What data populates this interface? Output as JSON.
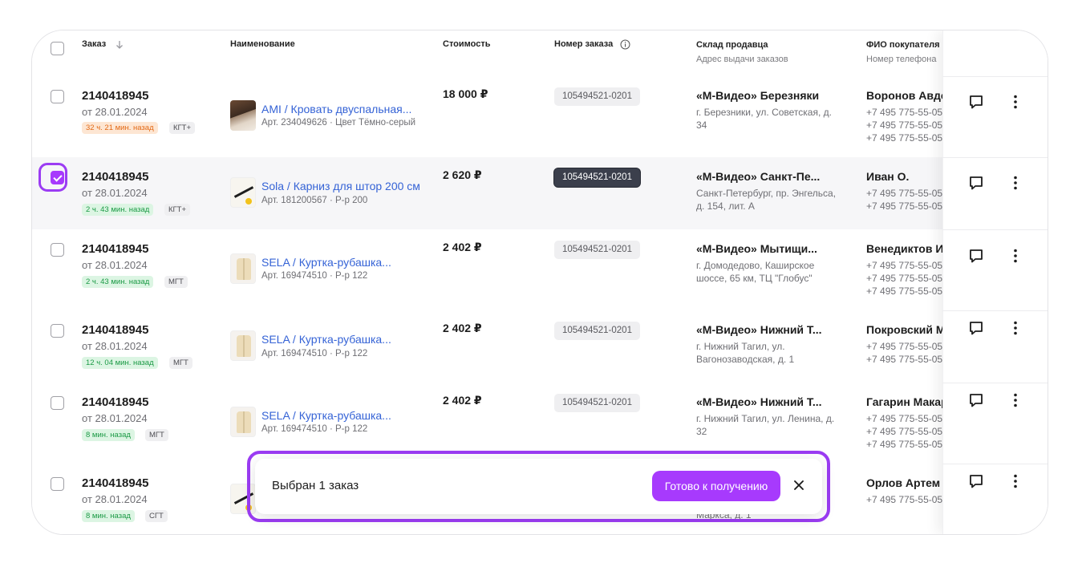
{
  "header": {
    "col_order": "Заказ",
    "col_name": "Наименование",
    "col_cost": "Стоимость",
    "col_order_number": "Номер заказа",
    "col_warehouse": "Склад продавца",
    "col_warehouse_sub": "Адрес выдачи заказов",
    "col_buyer": "ФИО покупателя",
    "col_buyer_sub": "Номер телефона"
  },
  "rows": [
    {
      "order": "2140418945",
      "date": "от 28.01.2024",
      "time_badge": "32 ч. 21 мин. назад",
      "time_badge_color": "#e36a16",
      "zone": "КГТ+",
      "product": "AMI / Кровать двуспальная...",
      "meta": "Арт. 234049626 · Цвет Тёмно-серый",
      "price": "18 000 ₽",
      "number": "105494521-0201",
      "warehouse": "«М-Видео» Березняки",
      "address": "г. Березники, ул. Советская, д. 34",
      "buyer": "Воронов Авдей",
      "phones": [
        "+7 495 775-55-05",
        "+7 495 775-55-05",
        "+7 495 775-55-05"
      ],
      "selected": false
    },
    {
      "order": "2140418945",
      "date": "от 28.01.2024",
      "time_badge": "2 ч. 43 мин. назад",
      "time_badge_color": "#1b9a45",
      "zone": "КГТ+",
      "product": "Sola / Карниз для штор 200 см",
      "meta": "Арт. 181200567 · Р-р 200",
      "price": "2 620 ₽",
      "number": "105494521-0201",
      "warehouse": "«М-Видео» Санкт-Пе...",
      "address": "Санкт-Петербург, пр. Энгельса, д. 154, лит. А",
      "buyer": "Иван О.",
      "phones": [
        "+7 495 775-55-05",
        "+7 495 775-55-05"
      ],
      "selected": true
    },
    {
      "order": "2140418945",
      "date": "от 28.01.2024",
      "time_badge": "2 ч. 43 мин. назад",
      "time_badge_color": "#1b9a45",
      "zone": "МГТ",
      "product": "SELA / Куртка-рубашка...",
      "meta": "Арт. 169474510 · Р-р 122",
      "price": "2 402 ₽",
      "number": "105494521-0201",
      "warehouse": "«М-Видео» Мытищи...",
      "address": "г. Домодедово, Каширское шоссе, 65 км, ТЦ \"Глобус\"",
      "buyer": "Венедиктов Иван",
      "phones": [
        "+7 495 775-55-05",
        "+7 495 775-55-05",
        "+7 495 775-55-05"
      ],
      "selected": false
    },
    {
      "order": "2140418945",
      "date": "от 28.01.2024",
      "time_badge": "12 ч. 04 мин. назад",
      "time_badge_color": "#1b9a45",
      "zone": "МГТ",
      "product": "SELA / Куртка-рубашка...",
      "meta": "Арт. 169474510 · Р-р 122",
      "price": "2 402 ₽",
      "number": "105494521-0201",
      "warehouse": "«М-Видео» Нижний Т...",
      "address": "г. Нижний Тагил, ул. Вагонозаводская, д. 1",
      "buyer": "Покровский Марк",
      "phones": [
        "+7 495 775-55-05",
        "+7 495 775-55-05"
      ],
      "selected": false
    },
    {
      "order": "2140418945",
      "date": "от 28.01.2024",
      "time_badge": "8 мин. назад",
      "time_badge_color": "#1b9a45",
      "zone": "МГТ",
      "product": "SELA / Куртка-рубашка...",
      "meta": "Арт. 169474510 · Р-р 122",
      "price": "2 402 ₽",
      "number": "105494521-0201",
      "warehouse": "«М-Видео» Нижний Т...",
      "address": "г. Нижний Тагил, ул. Ленина, д. 32",
      "buyer": "Гагарин Макар",
      "phones": [
        "+7 495 775-55-05",
        "+7 495 775-55-05",
        "+7 495 775-55-05"
      ],
      "selected": false
    },
    {
      "order": "2140418945",
      "date": "от 28.01.2024",
      "time_badge": "8 мин. назад",
      "time_badge_color": "#1b9a45",
      "zone": "СГТ",
      "product": "",
      "meta": "",
      "price": "",
      "number": "",
      "warehouse": "",
      "address": "Маркса, д. 1",
      "buyer": "Орлов Артем",
      "phones": [
        "+7 495 775-55-05"
      ],
      "selected": false
    }
  ],
  "toast": {
    "text": "Выбран 1 заказ",
    "button": "Готово к получению"
  },
  "accent_color": "#a73afd"
}
